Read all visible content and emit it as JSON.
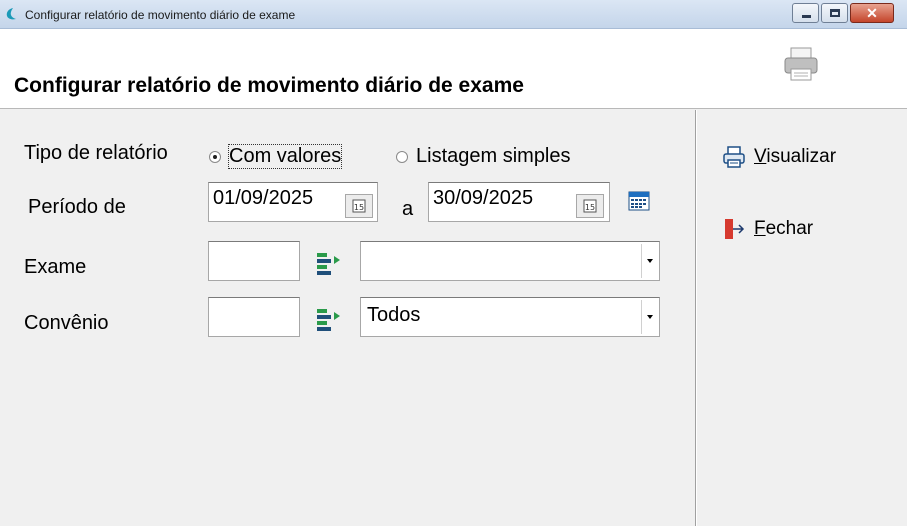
{
  "window": {
    "title": "Configurar relatório de movimento diário de exame",
    "close_glyph": "✕"
  },
  "header": {
    "title": "Configurar relatório de movimento diário de exame",
    "icon": "printer-icon"
  },
  "form": {
    "tipo_label": "Tipo de relatório",
    "radio_options": [
      {
        "label": "Com valores",
        "selected": true
      },
      {
        "label": "Listagem simples",
        "selected": false
      }
    ],
    "periodo_label": "Período de",
    "date_from": "01/09/2025",
    "date_separator": "a",
    "date_to": "30/09/2025",
    "date_button_text": "15",
    "exame_label": "Exame",
    "exame_code": "",
    "exame_combo_value": "",
    "convenio_label": "Convênio",
    "convenio_code": "",
    "convenio_combo_value": "Todos"
  },
  "actions": {
    "visualizar_accel": "V",
    "visualizar_rest": "isualizar",
    "fechar_accel": "F",
    "fechar_rest": "echar"
  },
  "colors": {
    "accent_green": "#2a9a4a",
    "close_red": "#c4452b"
  }
}
